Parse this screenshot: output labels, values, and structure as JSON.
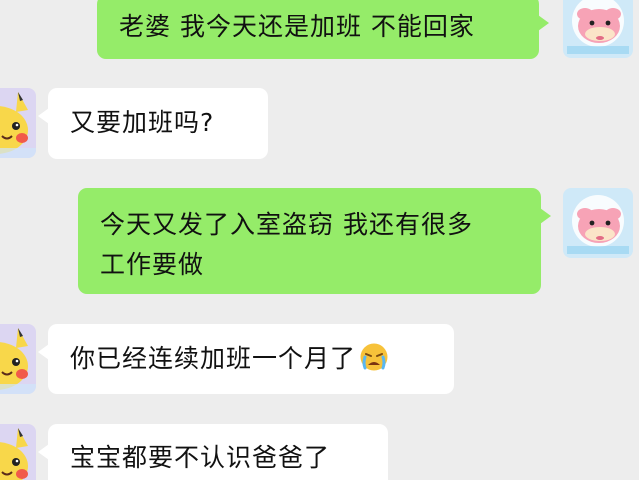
{
  "chat": {
    "messages": [
      {
        "sender": "me",
        "avatar": "slowpoke-avatar",
        "text": "老婆 我今天还是加班 不能回家"
      },
      {
        "sender": "other",
        "avatar": "pikachu-avatar",
        "text": "又要加班吗?"
      },
      {
        "sender": "me",
        "avatar": "slowpoke-avatar",
        "line1": "今天又发了入室盗窃 我还有很多",
        "line2": "工作要做"
      },
      {
        "sender": "other",
        "avatar": "pikachu-avatar",
        "text": "你已经连续加班一个月了",
        "emoji": "crying-face-emoji"
      },
      {
        "sender": "other",
        "avatar": "pikachu-avatar",
        "text": "宝宝都要不认识爸爸了"
      }
    ]
  },
  "colors": {
    "background": "#ededed",
    "my_bubble": "#95ec69",
    "other_bubble": "#ffffff",
    "text": "#111111"
  }
}
